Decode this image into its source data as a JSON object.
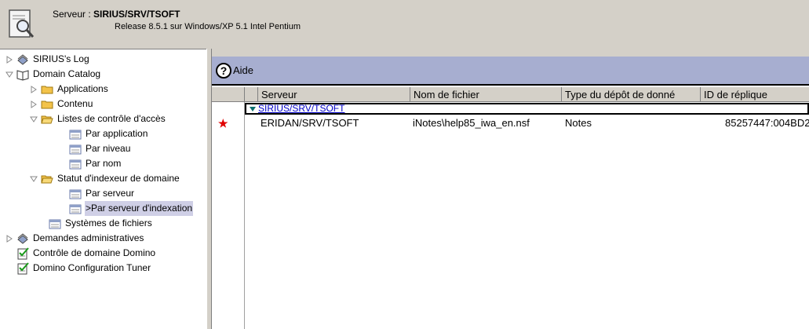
{
  "header": {
    "server_label": "Serveur : ",
    "server_name": "SIRIUS/SRV/TSOFT",
    "release": "Release 8.5.1 sur Windows/XP 5.1 Intel Pentium",
    "icon": "server-search-icon"
  },
  "tree": {
    "items": [
      {
        "label": "SIRIUS's Log",
        "icon": "log-icon"
      },
      {
        "label": "Domain Catalog",
        "icon": "book-icon"
      },
      {
        "label": "Applications",
        "icon": "folder-icon"
      },
      {
        "label": "Contenu",
        "icon": "folder-icon"
      },
      {
        "label": "Listes de contrôle d'accès",
        "icon": "folder-open-icon"
      },
      {
        "label": "Par application",
        "icon": "view-icon"
      },
      {
        "label": "Par niveau",
        "icon": "view-icon"
      },
      {
        "label": "Par nom",
        "icon": "view-icon"
      },
      {
        "label": "Statut d'indexeur de domaine",
        "icon": "folder-open-icon"
      },
      {
        "label": "Par serveur",
        "icon": "view-icon"
      },
      {
        "label": ">Par serveur d'indexation",
        "icon": "view-icon"
      },
      {
        "label": "Systèmes de fichiers",
        "icon": "view-icon"
      },
      {
        "label": "Demandes administratives",
        "icon": "log-icon"
      },
      {
        "label": "Contrôle de domaine Domino",
        "icon": "check-doc-icon"
      },
      {
        "label": "Domino Configuration Tuner",
        "icon": "check-doc-icon"
      }
    ]
  },
  "action_bar": {
    "help_label": "Aide",
    "help_icon": "help-icon"
  },
  "table": {
    "columns": [
      "Serveur",
      "Nom de fichier",
      "Type du dépôt de donné",
      "ID de réplique"
    ],
    "category": "SIRIUS/SRV/TSOFT",
    "unread_marker": "★",
    "rows": [
      [
        "ERIDAN/SRV/TSOFT",
        "iNotes\\help85_iwa_en.nsf",
        "Notes",
        "85257447:004BD2"
      ]
    ]
  },
  "colors": {
    "action_bar": "#a7aed0",
    "selection": "#cfcfe6",
    "category_link": "#0000c8",
    "unread_star": "#e00000"
  }
}
